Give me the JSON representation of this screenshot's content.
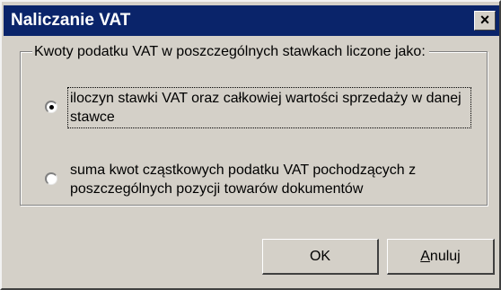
{
  "window": {
    "title": "Naliczanie VAT",
    "close_label": "×"
  },
  "group": {
    "label": "Kwoty podatku VAT w poszczególnych stawkach liczone jako:"
  },
  "options": [
    {
      "label": "iloczyn stawki VAT oraz całkowiej wartości sprzedaży w danej stawce",
      "selected": true
    },
    {
      "label": "suma kwot cząstkowych podatku VAT pochodzących z poszczególnych pozycji towarów dokumentów",
      "selected": false
    }
  ],
  "buttons": {
    "ok_label": "OK",
    "cancel_accel": "A",
    "cancel_rest": "nuluj"
  }
}
